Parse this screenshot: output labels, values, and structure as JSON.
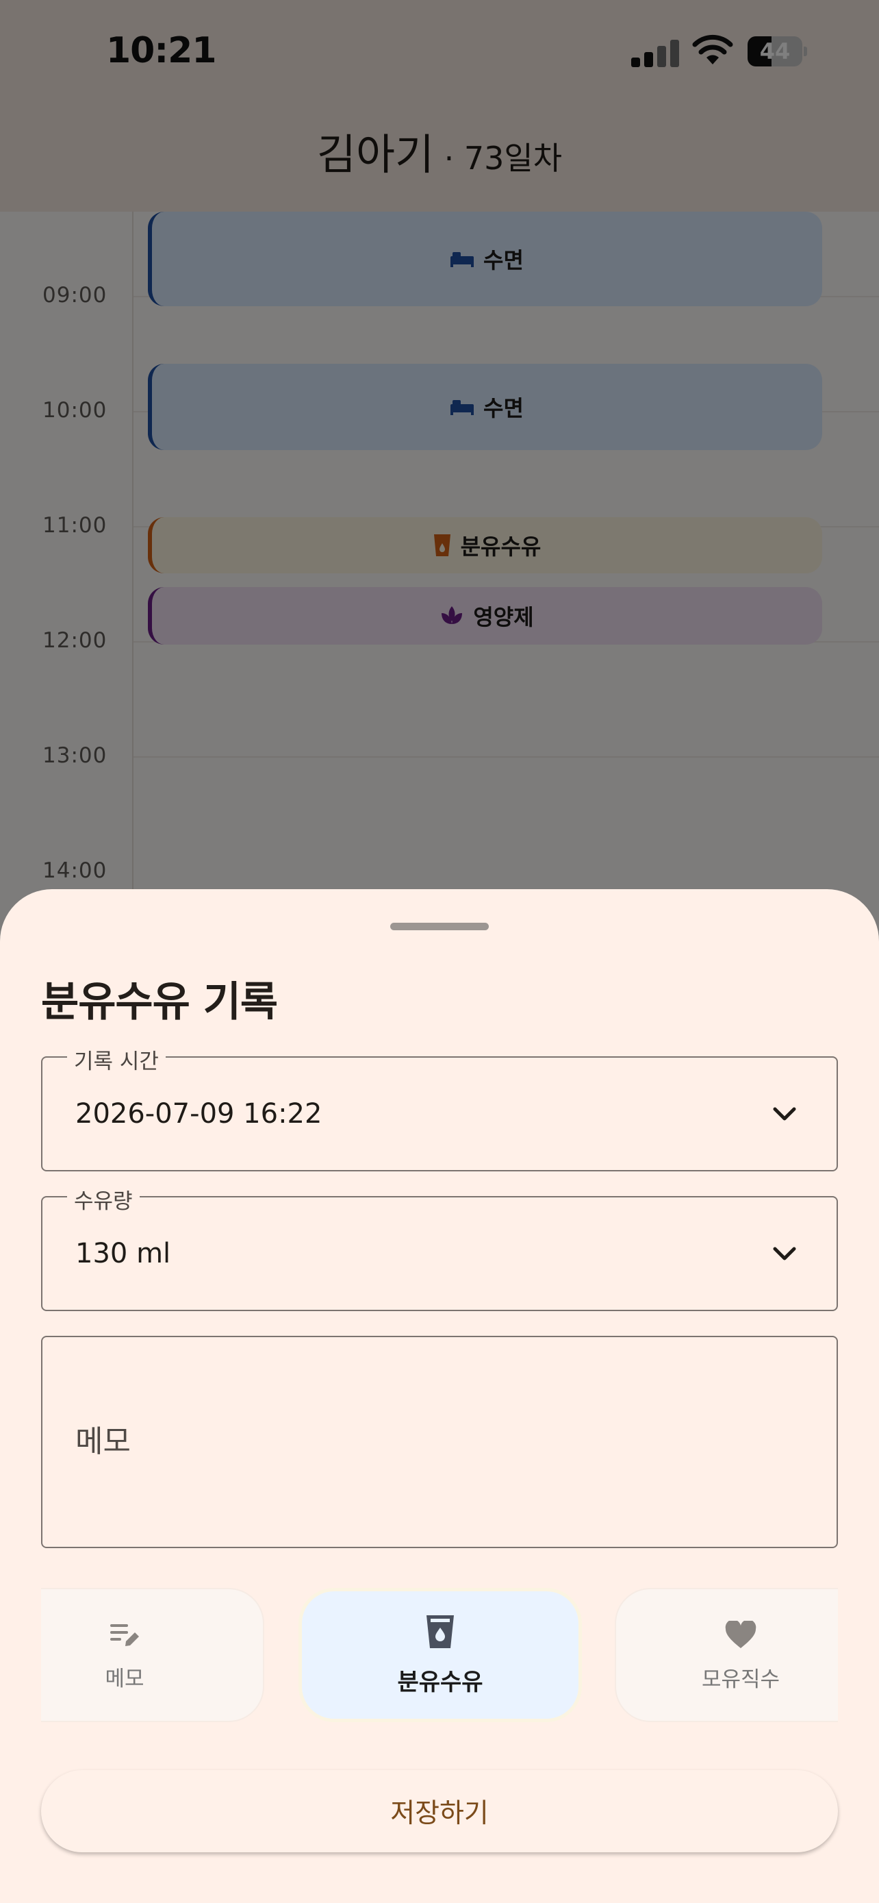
{
  "status_bar": {
    "time": "10:21",
    "battery": "44",
    "battery_level": 0.44
  },
  "header": {
    "baby_name": "김아기",
    "day_count": " · 73일차"
  },
  "timeline": {
    "hours": [
      "09:00",
      "10:00",
      "11:00",
      "12:00",
      "13:00",
      "14:00"
    ],
    "events": [
      {
        "type": "sleep",
        "label": "수면",
        "icon": "bed-icon"
      },
      {
        "type": "sleep",
        "label": "수면",
        "icon": "bed-icon"
      },
      {
        "type": "formula",
        "label": "분유수유",
        "icon": "cup-icon"
      },
      {
        "type": "supplement",
        "label": "영양제",
        "icon": "leaf-icon"
      }
    ]
  },
  "sheet": {
    "title": "분유수유 기록",
    "time_field": {
      "label": "기록 시간",
      "value": "2026-07-09 16:22"
    },
    "amount_field": {
      "label": "수유량",
      "value": "130 ml"
    },
    "memo_field": {
      "placeholder": "메모"
    },
    "type_chips": [
      {
        "label": "메모",
        "icon": "edit-note-icon",
        "selected": false
      },
      {
        "label": "분유수유",
        "icon": "cup-icon",
        "selected": true
      },
      {
        "label": "모유직수",
        "icon": "heart-icon",
        "selected": false
      }
    ],
    "save_label": "저장하기"
  },
  "colors": {
    "sheet_background": "#fff0e8",
    "sleep": "#1e4fa0",
    "formula": "#d06116",
    "supplement": "#6a1f86",
    "selected_chip": "#eaf3ff"
  }
}
